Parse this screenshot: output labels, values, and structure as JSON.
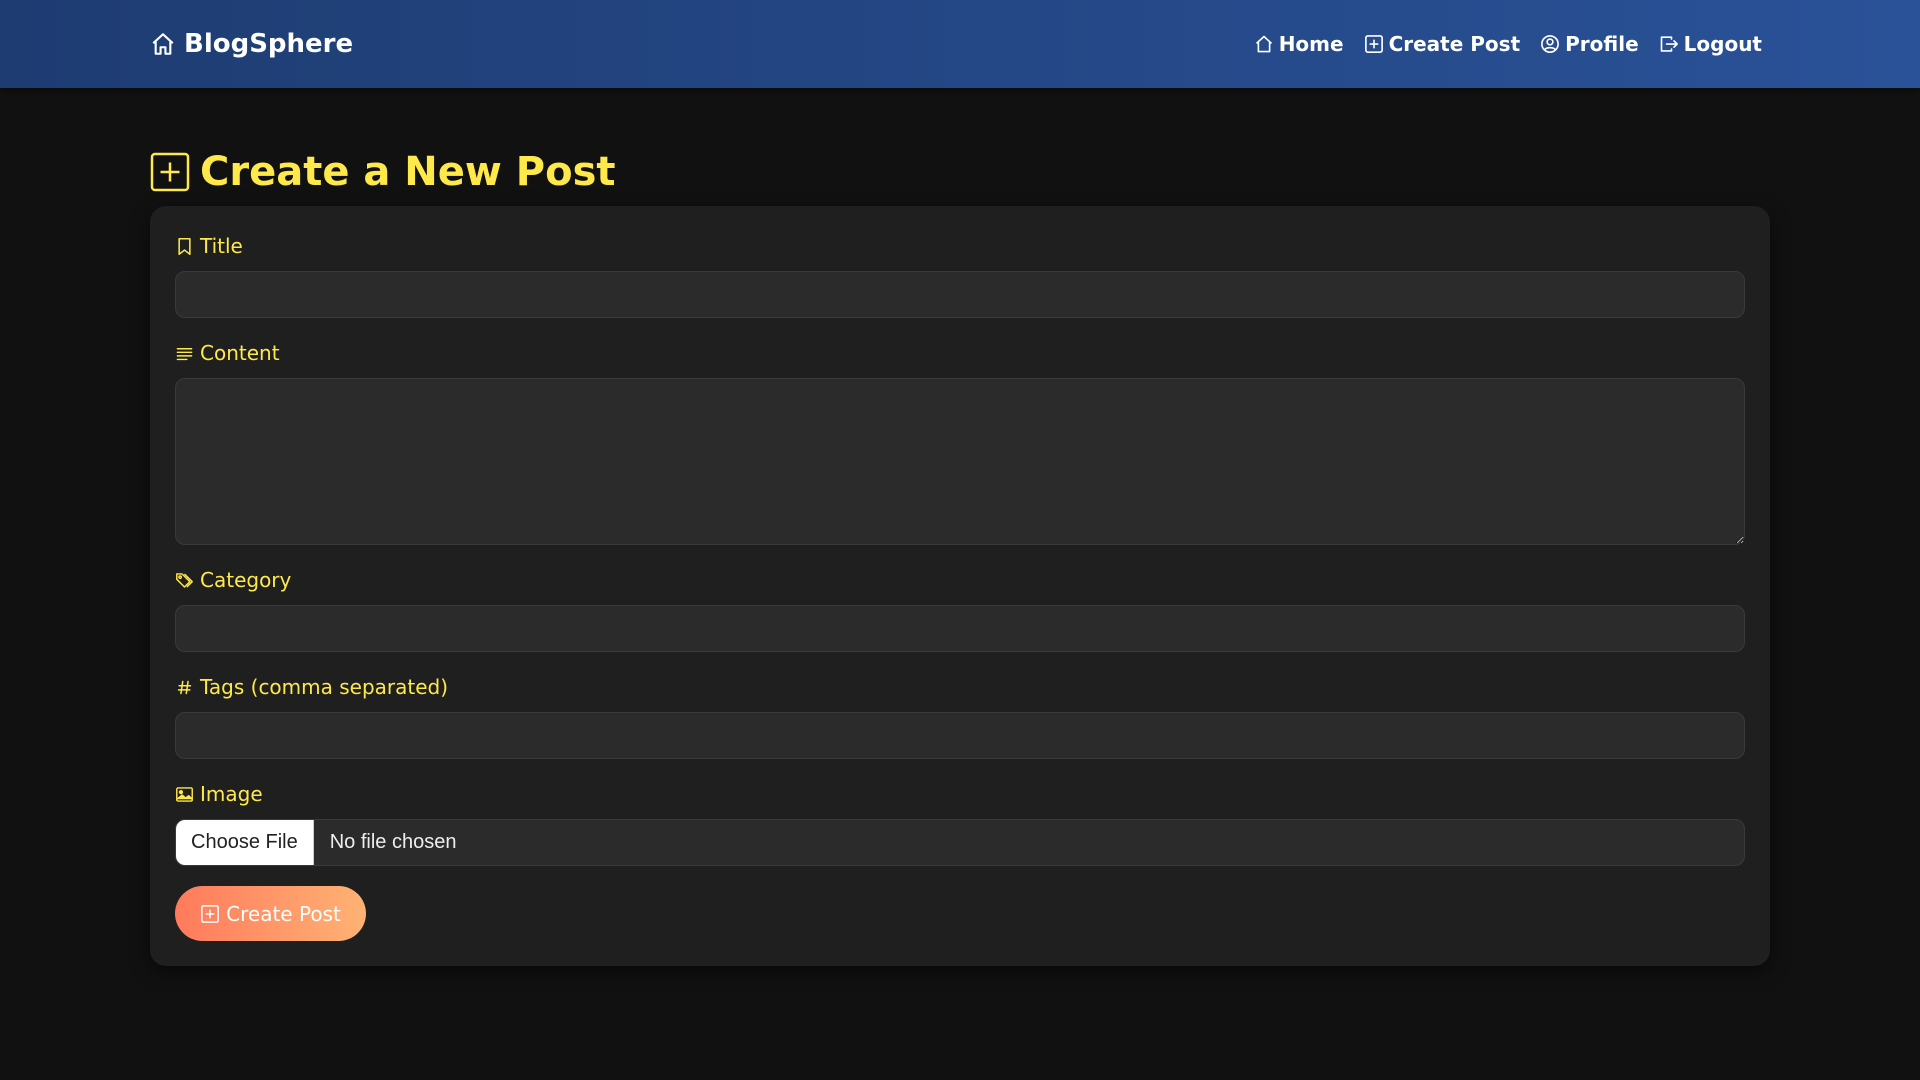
{
  "app": {
    "brand": "BlogSphere"
  },
  "nav": {
    "items": [
      {
        "label": "Home",
        "icon": "house-icon"
      },
      {
        "label": "Create Post",
        "icon": "plus-square-icon"
      },
      {
        "label": "Profile",
        "icon": "person-circle-icon"
      },
      {
        "label": "Logout",
        "icon": "box-arrow-right-icon"
      }
    ]
  },
  "page": {
    "heading": "Create a New Post"
  },
  "form": {
    "title_label": "Title",
    "title_value": "",
    "content_label": "Content",
    "content_value": "",
    "category_label": "Category",
    "category_value": "",
    "tags_label": "Tags (comma separated)",
    "tags_value": "",
    "image_label": "Image",
    "choose_file_label": "Choose File",
    "file_status": "No file chosen",
    "submit_label": "Create Post"
  },
  "colors": {
    "navbar_start": "#1e3c72",
    "navbar_end": "#2a5298",
    "accent_yellow": "#ffe94a",
    "background": "#111111",
    "card": "#1f1f1f",
    "button_start": "#ff7a5c",
    "button_end": "#ffb274"
  }
}
